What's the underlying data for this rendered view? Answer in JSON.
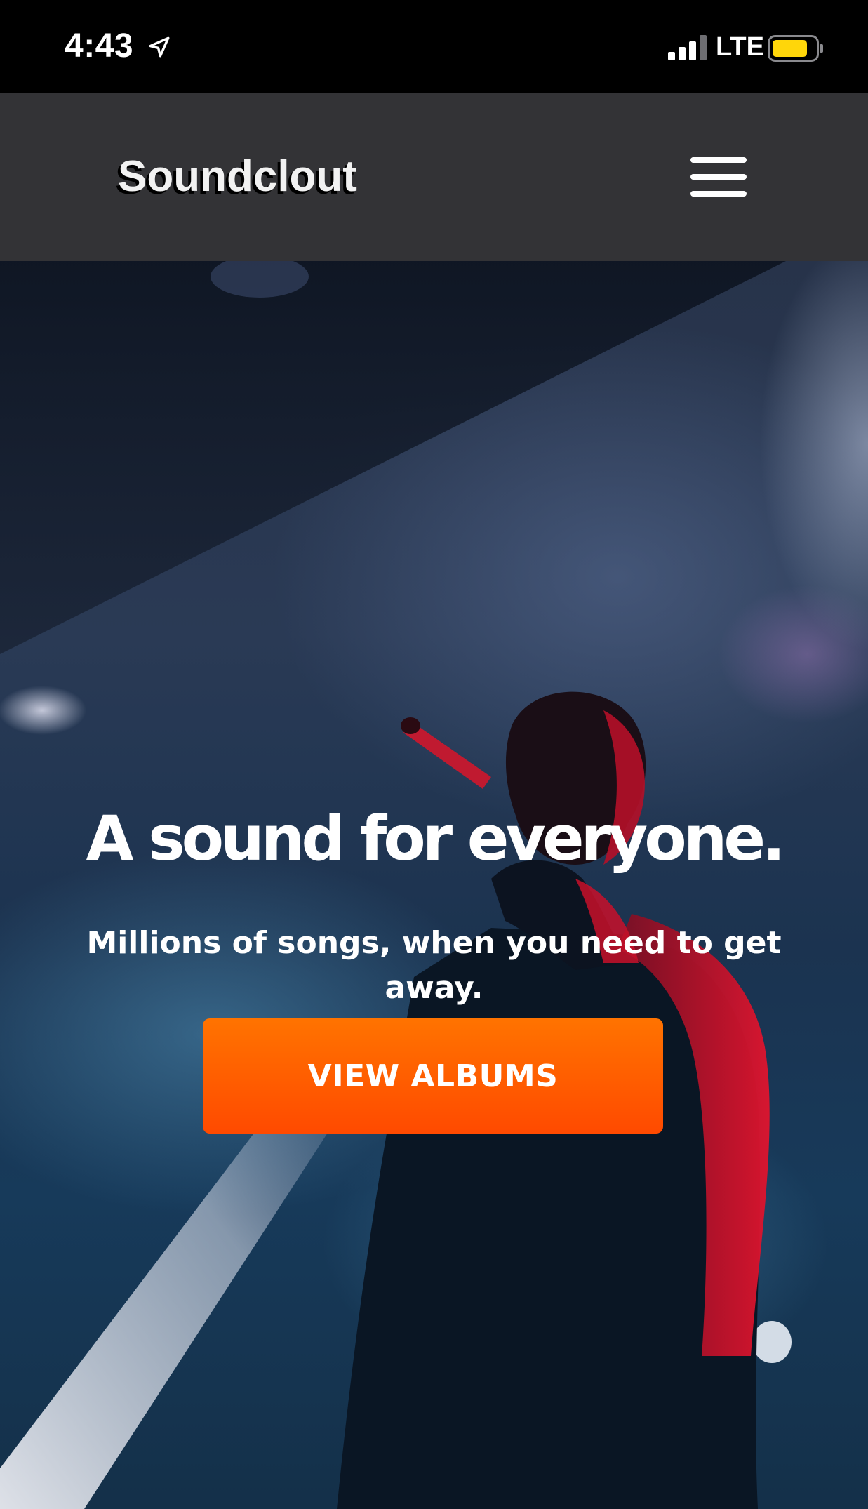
{
  "status_bar": {
    "time": "4:43",
    "network": "LTE",
    "location_icon": "location-arrow-icon",
    "signal_icon": "cellular-signal-icon",
    "battery_icon": "battery-icon",
    "battery_color": "#ffd60a"
  },
  "navbar": {
    "brand": "Soundclout",
    "menu_icon": "hamburger-menu-icon",
    "background": "#333336"
  },
  "hero": {
    "title": "A sound for everyone.",
    "subtitle": "Millions of songs, when you need to get away.",
    "cta_label": "VIEW ALBUMS",
    "cta_color": "#ff5a00"
  }
}
